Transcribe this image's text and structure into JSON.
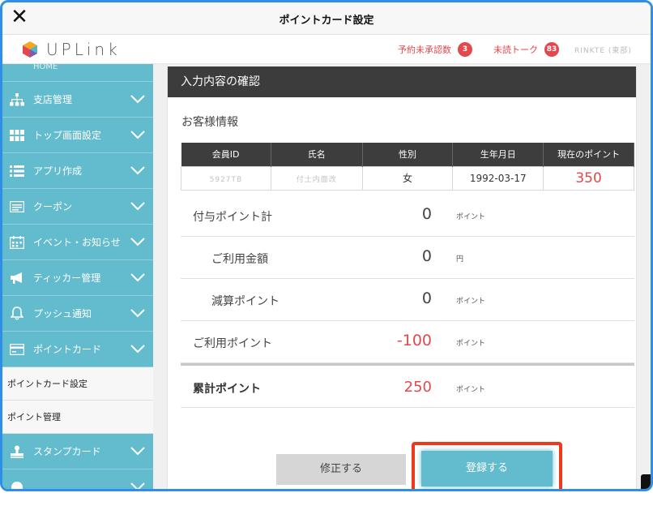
{
  "window": {
    "title": "ポイントカード設定",
    "close_label": "✕"
  },
  "header": {
    "logo_text": "UPLink",
    "pending_label": "予約未承認数",
    "pending_count": "3",
    "unread_label": "未読トーク",
    "unread_count": "83",
    "user_name": "RINKTE (東部)"
  },
  "sidebar": {
    "top_label": "HOME",
    "items": [
      {
        "label": "支店管理",
        "icon": "org-chart-icon"
      },
      {
        "label": "トップ画面設定",
        "icon": "grid-icon"
      },
      {
        "label": "アプリ作成",
        "icon": "list-icon"
      },
      {
        "label": "クーポン",
        "icon": "coupon-icon"
      },
      {
        "label": "イベント・お知らせ",
        "icon": "calendar-icon"
      },
      {
        "label": "ティッカー管理",
        "icon": "megaphone-icon"
      },
      {
        "label": "プッシュ通知",
        "icon": "bell-icon"
      },
      {
        "label": "ポイントカード",
        "icon": "card-icon"
      }
    ],
    "sub_items": [
      {
        "label": "ポイントカード設定"
      },
      {
        "label": "ポイント管理"
      }
    ],
    "stamp_label": "スタンプカード"
  },
  "panel": {
    "heading": "入力内容の確認",
    "section_title": "お客様情報",
    "table": {
      "headers": [
        "会員ID",
        "氏名",
        "性別",
        "生年月日",
        "現在のポイント"
      ],
      "row": {
        "member_id": "5927TB",
        "name": "付土内面改",
        "gender": "女",
        "birthdate": "1992-03-17",
        "points": "350"
      }
    },
    "summary": [
      {
        "label": "付与ポイント計",
        "value": "0",
        "unit": "ポイント"
      },
      {
        "label": "ご利用金額",
        "value": "0",
        "unit": "円"
      },
      {
        "label": "減算ポイント",
        "value": "0",
        "unit": "ポイント"
      },
      {
        "label": "ご利用ポイント",
        "value": "-100",
        "unit": "ポイント"
      },
      {
        "label": "累計ポイント",
        "value": "250",
        "unit": "ポイント"
      }
    ],
    "edit_button": "修正する",
    "register_button": "登録する"
  },
  "colors": {
    "accent": "#63bccd",
    "alert": "#e2484c",
    "highlight": "#ee3a1c",
    "dark": "#3c3c3c"
  }
}
